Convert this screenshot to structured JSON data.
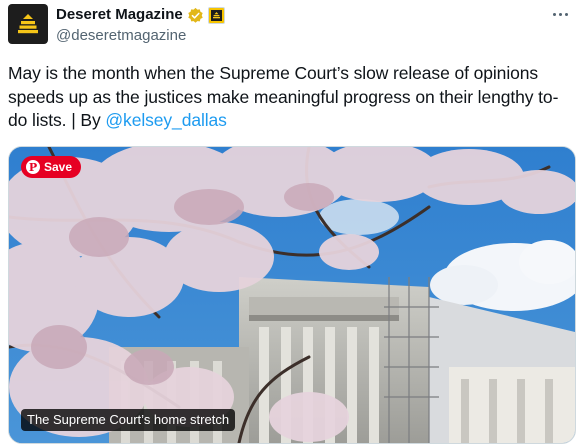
{
  "account": {
    "display_name": "Deseret Magazine",
    "handle": "@deseretmagazine",
    "avatar_icon": "beehive-icon",
    "verified_icon": "gold-verified-badge-icon",
    "affiliate_icon": "affiliate-badge-icon"
  },
  "menu": {
    "more_icon": "more-options-icon"
  },
  "tweet": {
    "text": "May is the month when the Supreme Court’s slow release of opinions speeds up as the justices make meaningful progress on their lengthy to-do lists. | By ",
    "mention": "@kelsey_dallas"
  },
  "media": {
    "pinterest_save_label": "Save",
    "caption": "The Supreme Court’s home stretch"
  },
  "colors": {
    "link": "#1d9bf0",
    "secondary_text": "#536471",
    "pinterest_red": "#e60023",
    "verified_gold": "#e2b719"
  }
}
